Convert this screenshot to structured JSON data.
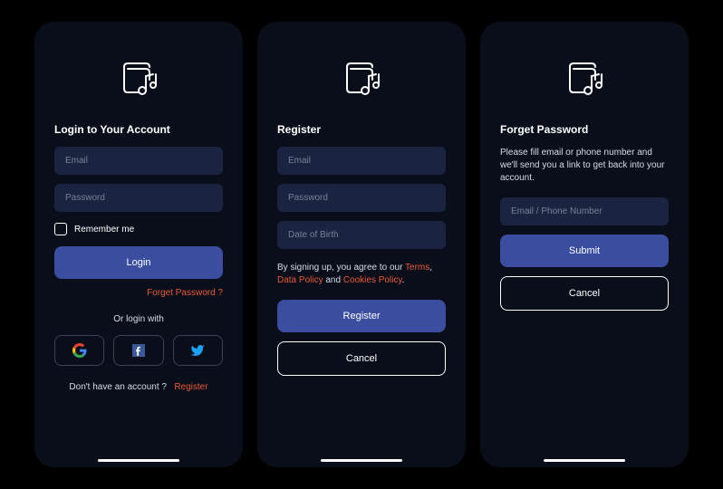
{
  "login": {
    "title": "Login to Your Account",
    "email_ph": "Email",
    "password_ph": "Password",
    "remember": "Remember me",
    "login_btn": "Login",
    "forget": "Forget Password ?",
    "or": "Or login with",
    "no_account": "Don't have an account ?",
    "register": "Register"
  },
  "register": {
    "title": "Register",
    "email_ph": "Email",
    "password_ph": "Password",
    "dob_ph": "Date of Birth",
    "consent_pre": "By signing up, you agree to our ",
    "terms": "Terms",
    "comma": ", ",
    "data_policy": "Data Policy",
    "and": " and ",
    "cookies": "Cookies Policy",
    "period": ".",
    "register_btn": "Register",
    "cancel_btn": "Cancel"
  },
  "forgot": {
    "title": "Forget Password",
    "subtitle": "Please fill email or phone number and we'll send you a link to get back into your account.",
    "input_ph": "Email / Phone Number",
    "submit_btn": "Submit",
    "cancel_btn": "Cancel"
  }
}
